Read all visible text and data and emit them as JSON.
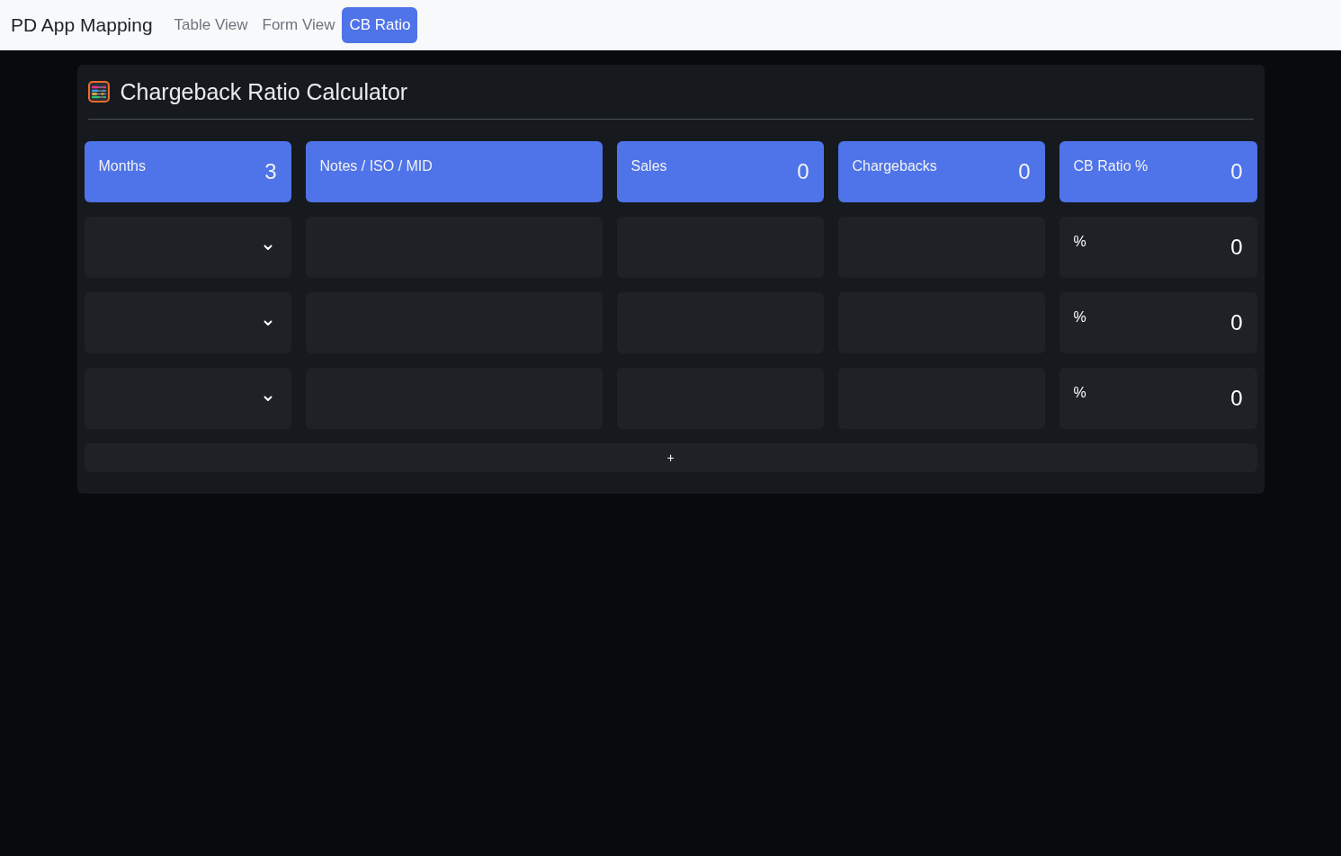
{
  "navbar": {
    "brand": "PD App Mapping",
    "links": [
      {
        "label": "Table View",
        "selected": false
      },
      {
        "label": "Form View",
        "selected": false
      },
      {
        "label": "CB Ratio",
        "selected": true
      }
    ]
  },
  "calculator": {
    "title": "Chargeback Ratio Calculator",
    "summary": [
      {
        "label": "Months",
        "value": "3"
      },
      {
        "label": "Notes / ISO / MID"
      },
      {
        "label": "Sales",
        "value": "0"
      },
      {
        "label": "Chargebacks",
        "value": "0"
      },
      {
        "label": "CB Ratio %",
        "value": "0"
      }
    ],
    "rows": [
      {
        "cb_ratio_unit": "%",
        "cb_ratio": "0"
      },
      {
        "cb_ratio_unit": "%",
        "cb_ratio": "0"
      },
      {
        "cb_ratio_unit": "%",
        "cb_ratio": "0"
      }
    ],
    "add_button": "+"
  }
}
